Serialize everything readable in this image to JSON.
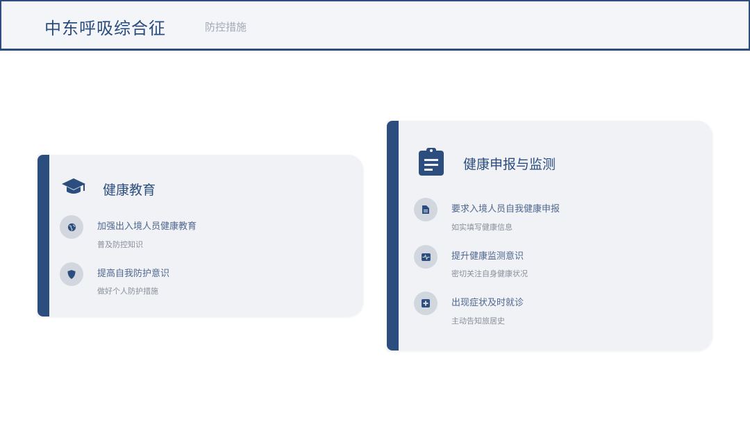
{
  "header": {
    "title": "中东呼吸综合征",
    "subtitle": "防控措施"
  },
  "colors": {
    "primary": "#2c4e7f",
    "card_bg": "#f0f2f6",
    "icon_bg": "#d2d6de"
  },
  "cards": {
    "education": {
      "title": "健康教育",
      "icon": "graduation-cap-icon",
      "items": [
        {
          "icon": "globe-icon",
          "title": "加强出入境人员健康教育",
          "sub": "普及防控知识"
        },
        {
          "icon": "shield-icon",
          "title": "提高自我防护意识",
          "sub": "做好个人防护措施"
        }
      ]
    },
    "monitoring": {
      "title": "健康申报与监测",
      "icon": "clipboard-icon",
      "items": [
        {
          "icon": "document-icon",
          "title": "要求入境人员自我健康申报",
          "sub": "如实填写健康信息"
        },
        {
          "icon": "heartbeat-monitor-icon",
          "title": "提升健康监测意识",
          "sub": "密切关注自身健康状况"
        },
        {
          "icon": "medical-cross-icon",
          "title": "出现症状及时就诊",
          "sub": "主动告知旅居史"
        }
      ]
    }
  }
}
